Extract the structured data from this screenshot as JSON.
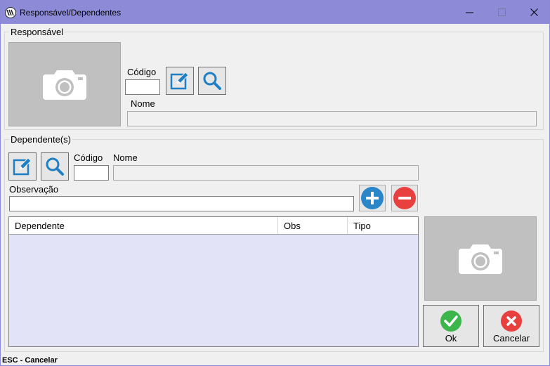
{
  "window": {
    "title": "Responsável/Dependentes",
    "min_symbol": "—",
    "max_symbol": "☐",
    "close_symbol": "✕"
  },
  "responsavel": {
    "group_title": "Responsável",
    "codigo_label": "Código",
    "codigo_value": "",
    "nome_label": "Nome",
    "nome_value": ""
  },
  "dependentes": {
    "group_title": "Dependente(s)",
    "codigo_label": "Código",
    "codigo_value": "",
    "nome_label": "Nome",
    "nome_value": "",
    "observacao_label": "Observação",
    "observacao_value": "",
    "grid": {
      "columns": [
        "Dependente",
        "Obs",
        "Tipo"
      ],
      "rows": []
    }
  },
  "buttons": {
    "ok_label": "Ok",
    "cancel_label": "Cancelar"
  },
  "status": {
    "text": "ESC - Cancelar"
  },
  "colors": {
    "titlebar": "#8d8bd8",
    "grid_background": "#e3e3f8",
    "edit_icon_blue": "#1f7fc4",
    "add_blue": "#2a86c8",
    "remove_red": "#e8403f",
    "ok_green": "#3cb54a",
    "cancel_red": "#e8403f"
  },
  "icons": {
    "app": "app-logo-icon",
    "photo": "camera-icon",
    "edit": "edit-icon",
    "search": "search-icon",
    "add": "plus-icon",
    "remove": "minus-icon",
    "ok": "check-icon",
    "cancel": "x-icon"
  }
}
